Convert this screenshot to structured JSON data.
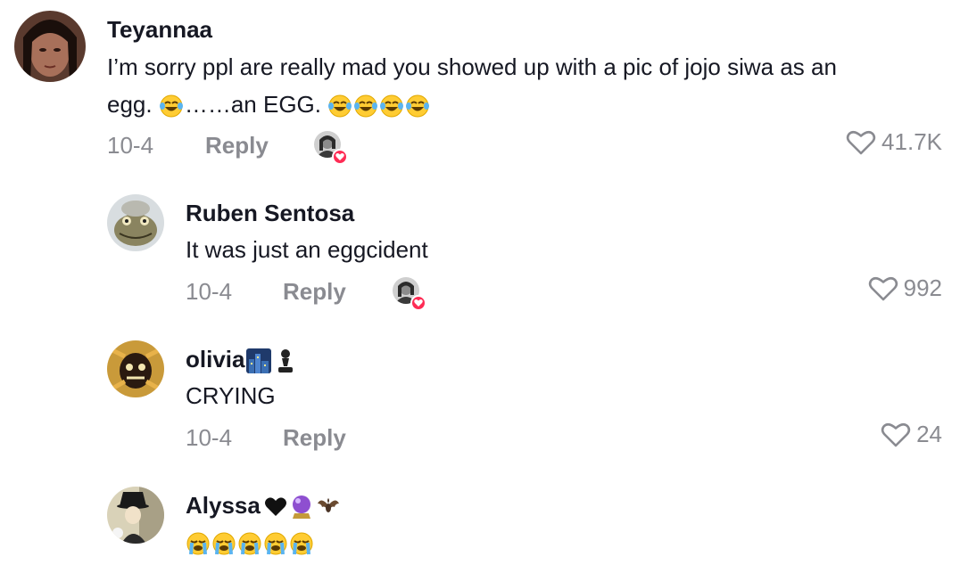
{
  "comments": [
    {
      "username": "Teyannaa",
      "text_line1": "I’m sorry ppl are really mad you showed up with a pic of jojo siwa as an",
      "text_line2_pre": "egg. ",
      "text_line2_mid": "……an EGG. ",
      "date": "10-4",
      "reply_label": "Reply",
      "likes": "41.7K",
      "creator_liked": true
    },
    {
      "username": "Ruben Sentosa",
      "text": "It was just an eggcident",
      "date": "10-4",
      "reply_label": "Reply",
      "likes": "992",
      "creator_liked": true
    },
    {
      "username": "olivia",
      "text": "CRYING",
      "date": "10-4",
      "reply_label": "Reply",
      "likes": "24",
      "creator_liked": false
    },
    {
      "username": "Alyssa",
      "text": "",
      "creator_liked": false
    }
  ],
  "icons": {
    "like": "heart-outline-icon",
    "creator_badge": "heart-badge-icon",
    "laughing_emoji": "face-with-tears-of-joy",
    "crying_emoji": "loudly-crying-face"
  },
  "colors": {
    "text": "#161823",
    "meta": "#8a8b91",
    "badge": "#fe2c55"
  }
}
